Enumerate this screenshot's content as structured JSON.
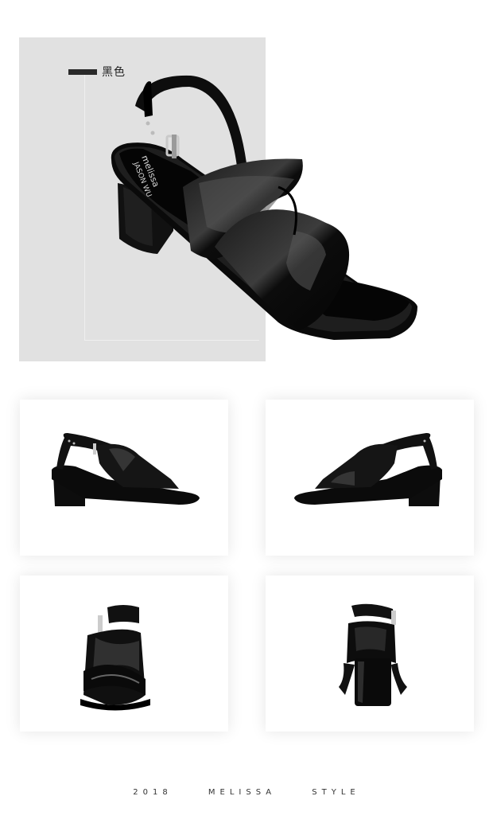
{
  "hero": {
    "color_label": "黑色",
    "brand_marks": [
      "melissa",
      "JASON WU"
    ]
  },
  "thumbnails": [
    {
      "view": "side-right"
    },
    {
      "view": "side-left"
    },
    {
      "view": "front"
    },
    {
      "view": "back"
    }
  ],
  "footer": {
    "year": "2018",
    "brand": "MELISSA",
    "word": "STYLE"
  },
  "colors": {
    "panel": "#e1e1e1",
    "shoe": "#0d0d0d",
    "shoe_highlight": "#4a4a4a"
  }
}
